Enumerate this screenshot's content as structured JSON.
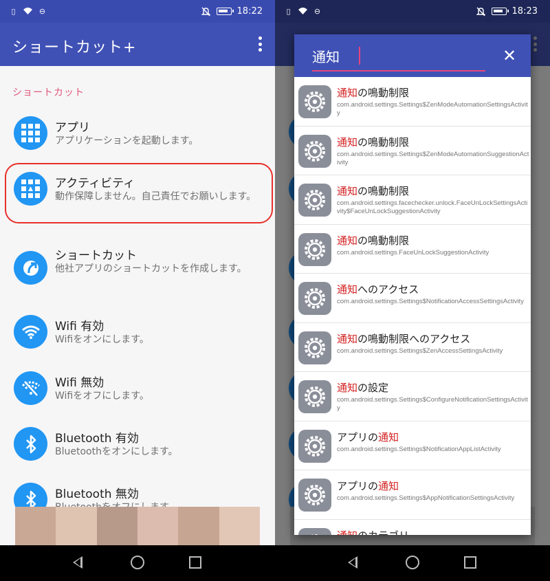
{
  "status": {
    "time_left": "18:22",
    "time_right": "18:23"
  },
  "app": {
    "title": "ショートカット+"
  },
  "section": {
    "header": "ショートカット"
  },
  "items": [
    {
      "title": "アプリ",
      "sub": "アプリケーションを起動します。"
    },
    {
      "title": "アクティビティ",
      "sub": "動作保障しません。自己責任でお願いします。"
    },
    {
      "title": "ショートカット",
      "sub": "他社アプリのショートカットを作成します。"
    },
    {
      "title": "Wifi 有効",
      "sub": "Wifiをオンにします。"
    },
    {
      "title": "Wifi 無効",
      "sub": "Wifiをオフにします。"
    },
    {
      "title": "Bluetooth 有効",
      "sub": "Bluetoothをオンにします。"
    },
    {
      "title": "Bluetooth 無効",
      "sub": "Bluetoothをオフにします。"
    }
  ],
  "search": {
    "query": "通知",
    "close": "✕"
  },
  "results": [
    {
      "hl": "通知",
      "rest": "の鳴動制限",
      "pre": "",
      "sub": "com.android.settings.Settings$ZenModeAutomationSettingsActivity"
    },
    {
      "hl": "通知",
      "rest": "の鳴動制限",
      "pre": "",
      "sub": "com.android.settings.Settings$ZenModeAutomationSuggestionActivity"
    },
    {
      "hl": "通知",
      "rest": "の鳴動制限",
      "pre": "",
      "sub": "com.android.settings.facechecker.unlock.FaceUnLockSettingsActivity$FaceUnLockSuggestionActivity"
    },
    {
      "hl": "通知",
      "rest": "の鳴動制限",
      "pre": "",
      "sub": "com.android.settings.FaceUnLockSuggestionActivity"
    },
    {
      "hl": "通知",
      "rest": "へのアクセス",
      "pre": "",
      "sub": "com.android.settings.Settings$NotificationAccessSettingsActivity"
    },
    {
      "hl": "通知",
      "rest": "の鳴動制限へのアクセス",
      "pre": "",
      "sub": "com.android.settings.Settings$ZenAccessSettingsActivity"
    },
    {
      "hl": "通知",
      "rest": "の設定",
      "pre": "",
      "sub": "com.android.settings.Settings$ConfigureNotificationSettingsActivity"
    },
    {
      "hl": "通知",
      "rest": "",
      "pre": "アプリの",
      "sub": "com.android.settings.Settings$NotificationAppListActivity"
    },
    {
      "hl": "通知",
      "rest": "",
      "pre": "アプリの",
      "sub": "com.android.settings.Settings$AppNotificationSettingsActivity"
    },
    {
      "hl": "通知",
      "rest": "のカテゴリ",
      "pre": "",
      "sub": ""
    }
  ],
  "colors": {
    "primary": "#3f51b5",
    "accent": "#e0577a",
    "icon": "#2196f3",
    "highlight": "#d32020",
    "outline": "#e8302a"
  }
}
